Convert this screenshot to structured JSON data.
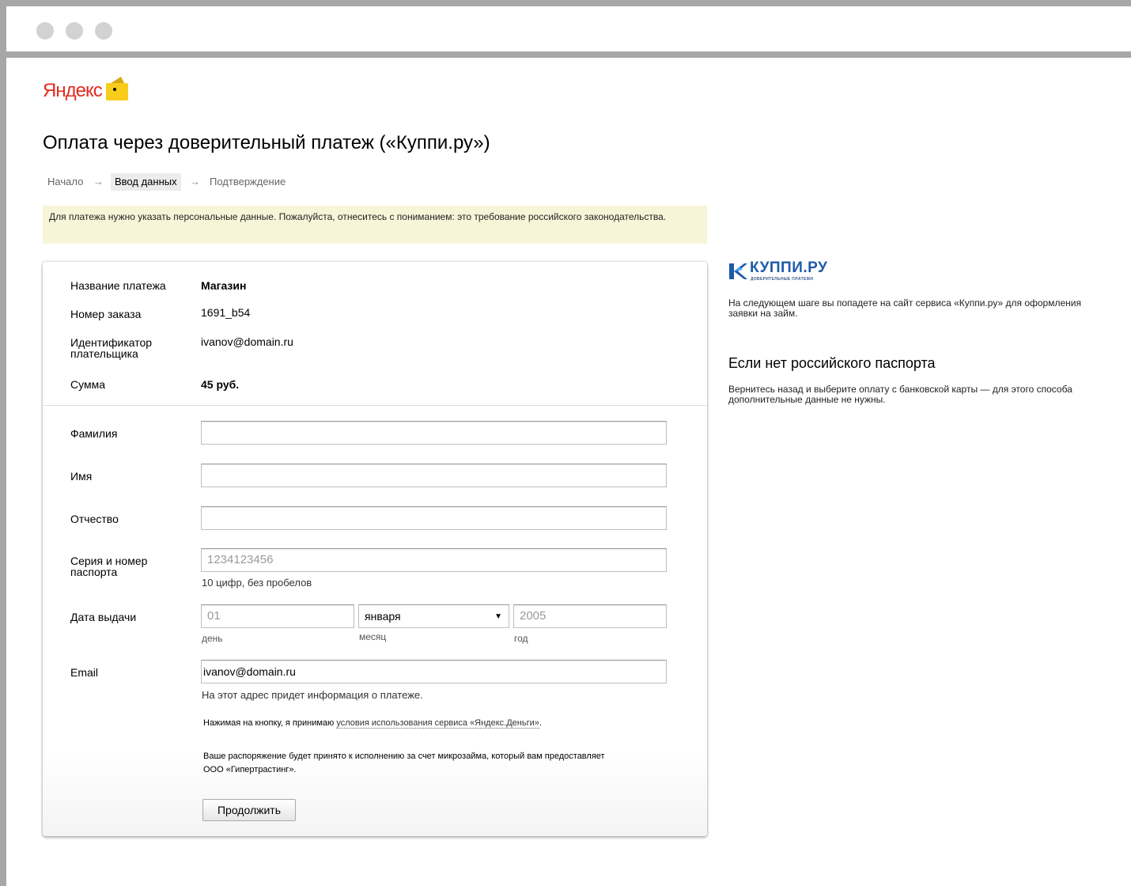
{
  "brand": {
    "logo_text": "Яндекс"
  },
  "page": {
    "title": "Оплата через доверительный платеж («Куппи.ру»)"
  },
  "steps": [
    {
      "label": "Начало",
      "active": false
    },
    {
      "label": "Ввод данных",
      "active": true
    },
    {
      "label": "Подтверждение",
      "active": false
    }
  ],
  "step_separator": "→",
  "notice": {
    "text": "Для платежа нужно указать персональные данные. Пожалуйста, отнеситесь с пониманием: это требование российского законодательства."
  },
  "summary": {
    "payment_name_label": "Название платежа",
    "payment_name_value": "Магазин",
    "order_number_label": "Номер заказа",
    "order_number_value": "1691_b54",
    "payer_id_label": "Идентификатор плательщика",
    "payer_id_value": "ivanov@domain.ru",
    "amount_label": "Сумма",
    "amount_value": "45 руб."
  },
  "form": {
    "surname_label": "Фамилия",
    "surname_value": "",
    "name_label": "Имя",
    "name_value": "",
    "patronymic_label": "Отчество",
    "patronymic_value": "",
    "passport_label": "Серия и номер паспорта",
    "passport_placeholder": "1234123456",
    "passport_hint": "10 цифр, без пробелов",
    "issue_date_label": "Дата выдачи",
    "day_placeholder": "01",
    "day_caption": "день",
    "month_value": "января",
    "month_caption": "месяц",
    "year_placeholder": "2005",
    "year_caption": "год",
    "email_label": "Email",
    "email_value": "ivanov@domain.ru",
    "email_hint": "На этот адрес придет информация о платеже.",
    "terms_prefix": "Нажимая на кнопку, я принимаю ",
    "terms_link": "условия использования сервиса «Яндекс.Деньги»",
    "terms_suffix": ".",
    "microloan_text_line1": "Ваше распоряжение будет принято к исполнению за счет микрозайма, который вам предоставляет",
    "microloan_text_line2": "ООО «Гипертрастинг».",
    "submit_label": "Продолжить"
  },
  "sidebar": {
    "partner_name": "КУППИ.РУ",
    "partner_tagline": "ДОВЕРИТЕЛЬНЫЕ ПЛАТЕЖИ",
    "next_step_text": "На следующем шаге вы попадете на сайт сервиса «Куппи.ру» для оформления заявки на займ.",
    "no_passport_heading": "Если нет российского паспорта",
    "no_passport_text": "Вернитесь назад и выберите оплату с банковской карты — для этого способа дополнительные данные не нужны."
  },
  "colors": {
    "yandex_red": "#e32b20",
    "wallet_yellow": "#f8cc1b",
    "notice_bg": "#f7f5d8",
    "kuppi_blue": "#1e5aa8"
  }
}
